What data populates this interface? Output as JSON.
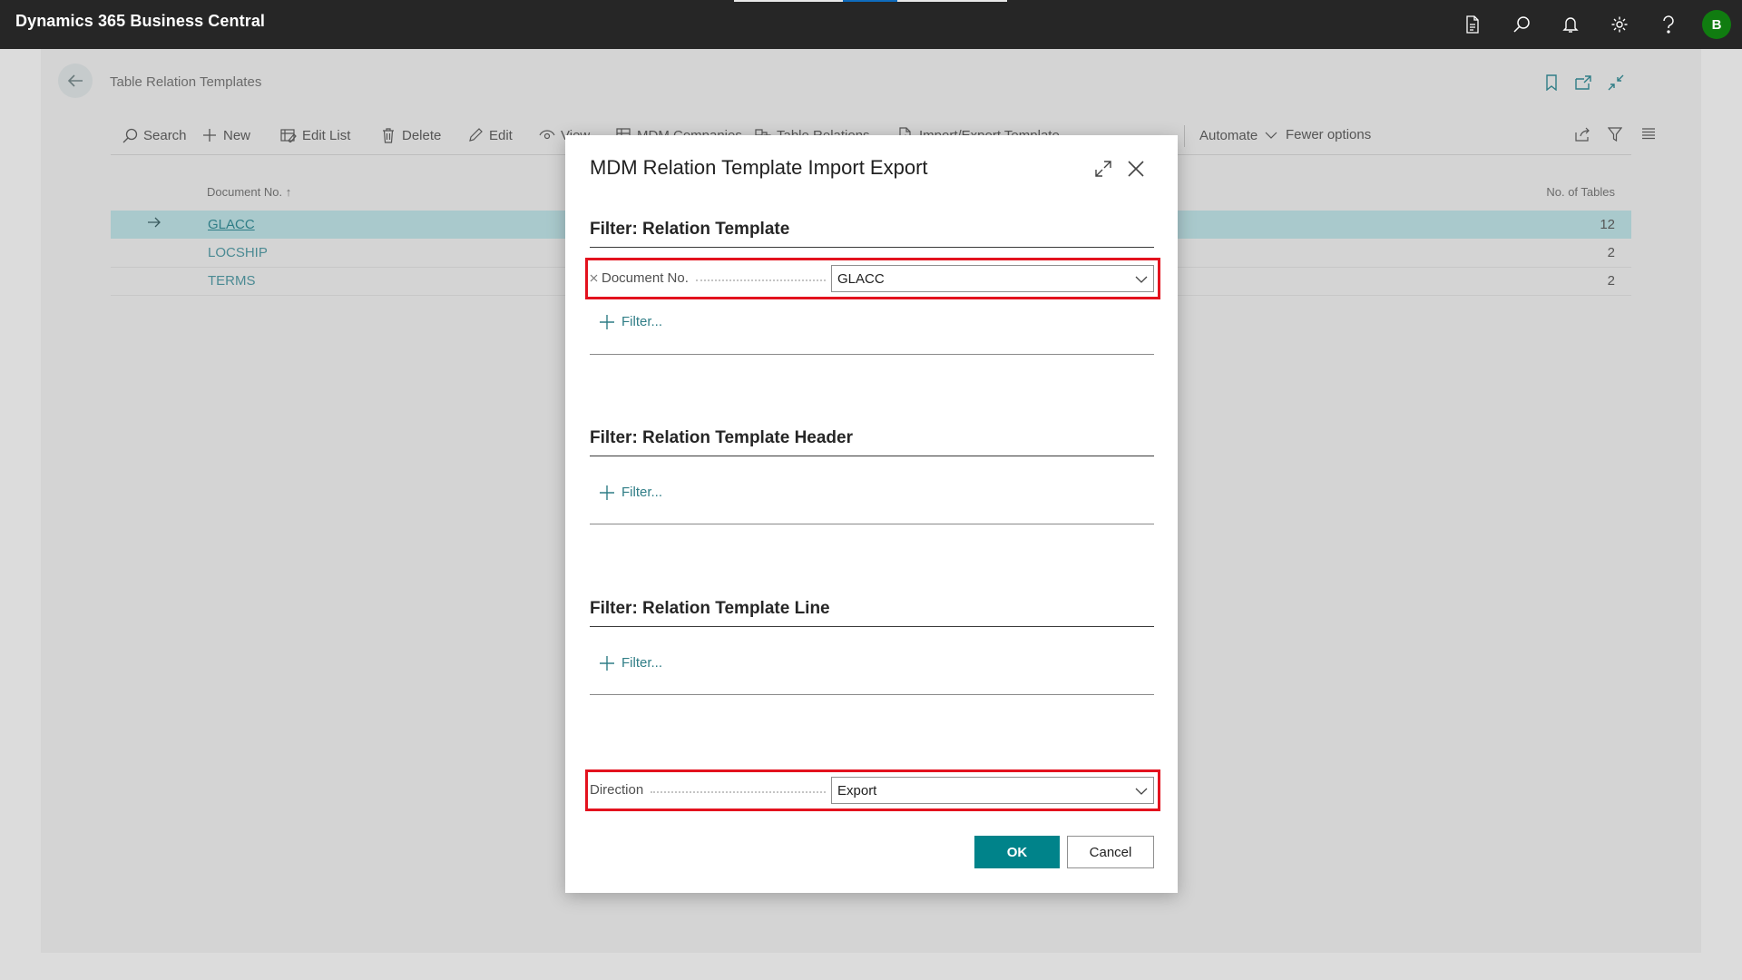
{
  "app": {
    "title": "Dynamics 365 Business Central",
    "user_initial": "B",
    "icons": [
      "document-icon",
      "search-icon",
      "bell-icon",
      "gear-icon",
      "help-icon"
    ]
  },
  "page": {
    "title": "Table Relation Templates",
    "header_icons": [
      "bookmark-icon",
      "open-in-new-icon",
      "collapse-icon"
    ]
  },
  "actions": {
    "search": "Search",
    "new": "New",
    "edit_list": "Edit List",
    "delete": "Delete",
    "edit": "Edit",
    "view": "View",
    "mdm_companies": "MDM Companies",
    "table_relations": "Table Relations",
    "import_export_template": "Import/Export Template",
    "automate": "Automate",
    "fewer_options": "Fewer options"
  },
  "list": {
    "columns": {
      "document_no": "Document No.",
      "sort_indicator": "↑",
      "no_of_tables": "No. of Tables"
    },
    "rows": [
      {
        "document_no": "GLACC",
        "no_of_tables": "12",
        "selected": true
      },
      {
        "document_no": "LOCSHIP",
        "no_of_tables": "2",
        "selected": false
      },
      {
        "document_no": "TERMS",
        "no_of_tables": "2",
        "selected": false
      }
    ]
  },
  "dialog": {
    "title": "MDM Relation Template Import Export",
    "sections": [
      {
        "title": "Filter: Relation Template",
        "filter_field": {
          "label": "Document No.",
          "value": "GLACC"
        },
        "add_filter": "Filter..."
      },
      {
        "title": "Filter: Relation Template Header",
        "add_filter": "Filter..."
      },
      {
        "title": "Filter: Relation Template Line",
        "add_filter": "Filter..."
      }
    ],
    "direction": {
      "label": "Direction",
      "value": "Export"
    },
    "ok": "OK",
    "cancel": "Cancel"
  },
  "colors": {
    "accent": "#00838a",
    "highlight": "#e3121e",
    "selected_row": "#a9c9cc",
    "topbar": "#262626",
    "avatar": "#107c10"
  }
}
